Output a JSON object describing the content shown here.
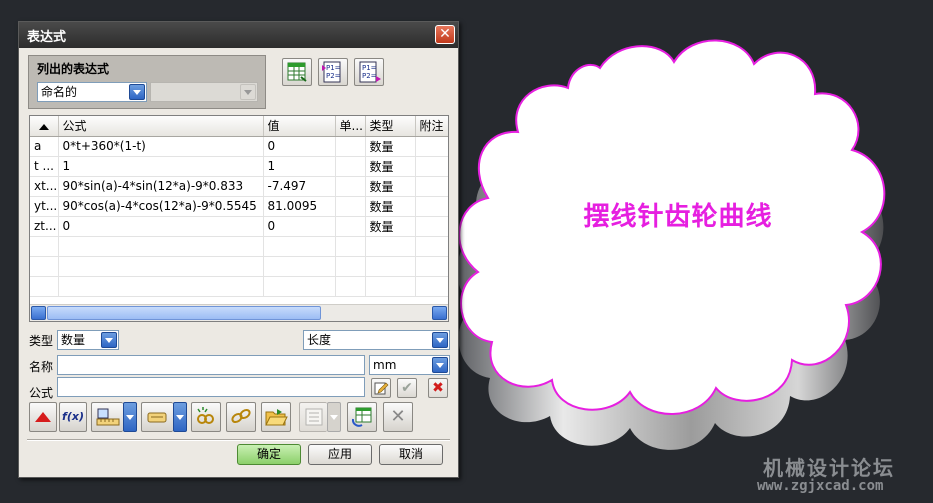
{
  "window": {
    "title": "表达式"
  },
  "group": {
    "title": "列出的表达式",
    "filter_value": "命名的",
    "secondary_value": ""
  },
  "toolbar_icons": [
    "spreadsheet-icon",
    "export-p1p2-icon",
    "import-p1p2-icon"
  ],
  "table": {
    "columns": [
      "公式",
      "值",
      "单...",
      "类型",
      "附注"
    ],
    "rows": [
      {
        "name": "a",
        "formula": "0*t+360*(1-t)",
        "value": "0",
        "unit": "",
        "type": "数量",
        "note": ""
      },
      {
        "name": "t ...",
        "formula": "1",
        "value": "1",
        "unit": "",
        "type": "数量",
        "note": ""
      },
      {
        "name": "xt...",
        "formula": "90*sin(a)-4*sin(12*a)-9*0.833",
        "value": "-7.497",
        "unit": "",
        "type": "数量",
        "note": ""
      },
      {
        "name": "yt...",
        "formula": "90*cos(a)-4*cos(12*a)-9*0.5545",
        "value": "81.0095",
        "unit": "",
        "type": "数量",
        "note": ""
      },
      {
        "name": "zt...",
        "formula": "0",
        "value": "0",
        "unit": "",
        "type": "数量",
        "note": ""
      }
    ]
  },
  "form": {
    "type_label": "类型",
    "type_value": "数量",
    "dimension_value": "长度",
    "name_label": "名称",
    "name_value": "",
    "unit_value": "mm",
    "formula_label": "公式",
    "formula_value": ""
  },
  "tools": {
    "function_label": "f(x)"
  },
  "actions": {
    "ok": "确定",
    "apply": "应用",
    "cancel": "取消"
  },
  "model": {
    "title": "摆线针齿轮曲线"
  },
  "watermark": {
    "line1": "机械设计论坛",
    "line2": "www.zgjxcad.com"
  },
  "colors": {
    "curve": "#e61fe0",
    "primary_button": "#8cd06a"
  }
}
